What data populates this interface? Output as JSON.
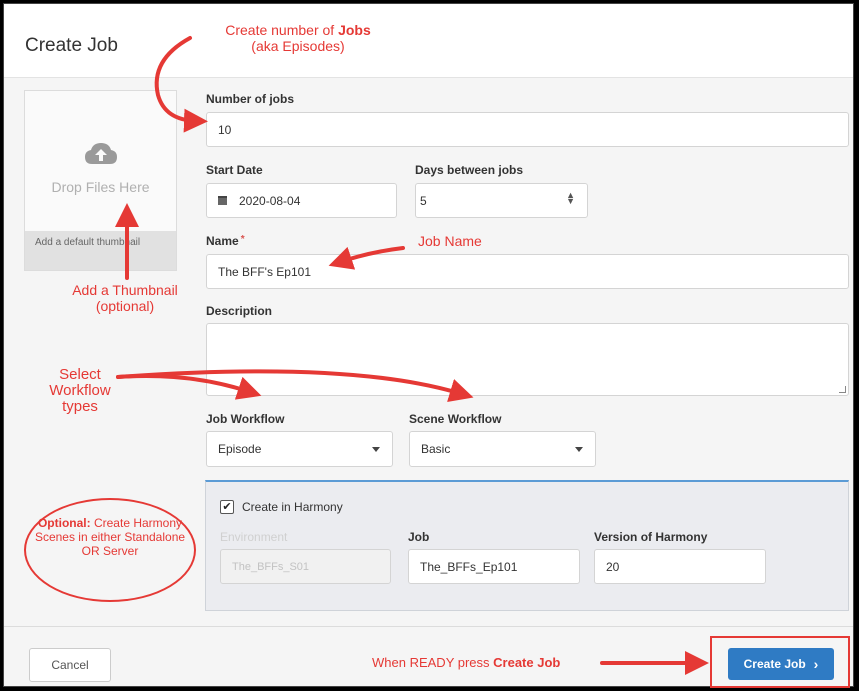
{
  "dialog": {
    "title": "Create Job"
  },
  "dropzone": {
    "drop_text": "Drop Files Here",
    "thumbnail_label": "Add a default thumbnail",
    "icon": "cloud-upload-icon"
  },
  "form": {
    "number_of_jobs": {
      "label": "Number of jobs",
      "value": "10"
    },
    "start_date": {
      "label": "Start Date",
      "value": "2020-08-04",
      "icon": "calendar-icon"
    },
    "days_between": {
      "label": "Days between jobs",
      "value": "5"
    },
    "name": {
      "label": "Name",
      "required_mark": "*",
      "value": "The BFF's Ep101"
    },
    "description": {
      "label": "Description",
      "value": ""
    },
    "job_workflow": {
      "label": "Job Workflow",
      "value": "Episode"
    },
    "scene_workflow": {
      "label": "Scene Workflow",
      "value": "Basic"
    }
  },
  "harmony": {
    "checkbox_label": "Create in Harmony",
    "checked": true,
    "environment": {
      "label": "Environment",
      "value": "The_BFFs_S01"
    },
    "job": {
      "label": "Job",
      "value": "The_BFFs_Ep101"
    },
    "version": {
      "label": "Version of Harmony",
      "value": "20"
    }
  },
  "footer": {
    "cancel_label": "Cancel",
    "create_label": "Create Job"
  },
  "annotations": {
    "jobs_line1": "Create number of ",
    "jobs_bold": "Jobs",
    "jobs_line2": "(aka Episodes)",
    "job_name": "Job Name",
    "thumbnail_line1": "Add a Thumbnail",
    "thumbnail_line2": "(optional)",
    "workflow": "Select Workflow types",
    "optional_bold": "Optional:",
    "optional_text": " Create Harmony Scenes in either Standalone OR Server",
    "ready_prefix": "When READY press ",
    "ready_bold": "Create Job"
  },
  "colors": {
    "annotation": "#e53935",
    "primary_button": "#2f7bc4",
    "panel_accent": "#5b9bd5"
  }
}
